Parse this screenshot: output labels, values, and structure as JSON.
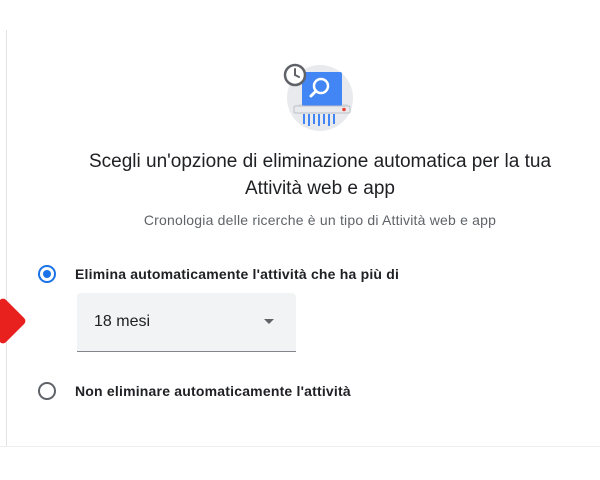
{
  "dialog": {
    "title_line1": "Scegli un'opzione di eliminazione automatica per la tua",
    "title_line2": "Attività web e app",
    "subtitle": "Cronologia delle ricerche è un tipo di Attività web e app",
    "illustration_icon": "history-shredder-icon"
  },
  "options": [
    {
      "label": "Elimina automaticamente l'attività che ha più di",
      "selected": true
    },
    {
      "label": "Non eliminare automaticamente l'attività",
      "selected": false
    }
  ],
  "retention_select": {
    "value": "18 mesi"
  },
  "colors": {
    "accent": "#1a73e8",
    "select_bg": "#f1f3f4",
    "subtitle": "#5f6368",
    "marker": "#e8201e"
  }
}
